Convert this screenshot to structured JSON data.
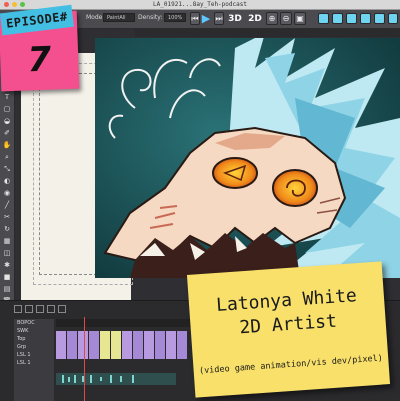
{
  "window": {
    "title": "LA_01921...8ay_Teh-podcast"
  },
  "toolbar": {
    "mode_label": "Mode:",
    "mode_value": "PaintAll",
    "density_label": "Density:",
    "density_value": "100%",
    "btn_3d": "3D",
    "btn_2d": "2D",
    "play_icon": "play-icon",
    "accent": "#6fd4f0"
  },
  "episode": {
    "heading": "EPISODE#",
    "number": "7",
    "note_color": "#f4508f",
    "heading_color": "#42bfe3"
  },
  "guest": {
    "name": "Latonya White",
    "role": "2D Artist",
    "subtitle": "(video game animation/vis dev/pixel)",
    "note_color": "#f8e06a"
  },
  "timeline": {
    "tracks": [
      "BOPOC",
      "SWK",
      "Top",
      "Grp",
      "LSL 1",
      "LSL 1"
    ]
  },
  "colors": {
    "frame_purple": "#b79adf",
    "frame_yellow": "#e6e693",
    "playhead": "#e04848"
  }
}
